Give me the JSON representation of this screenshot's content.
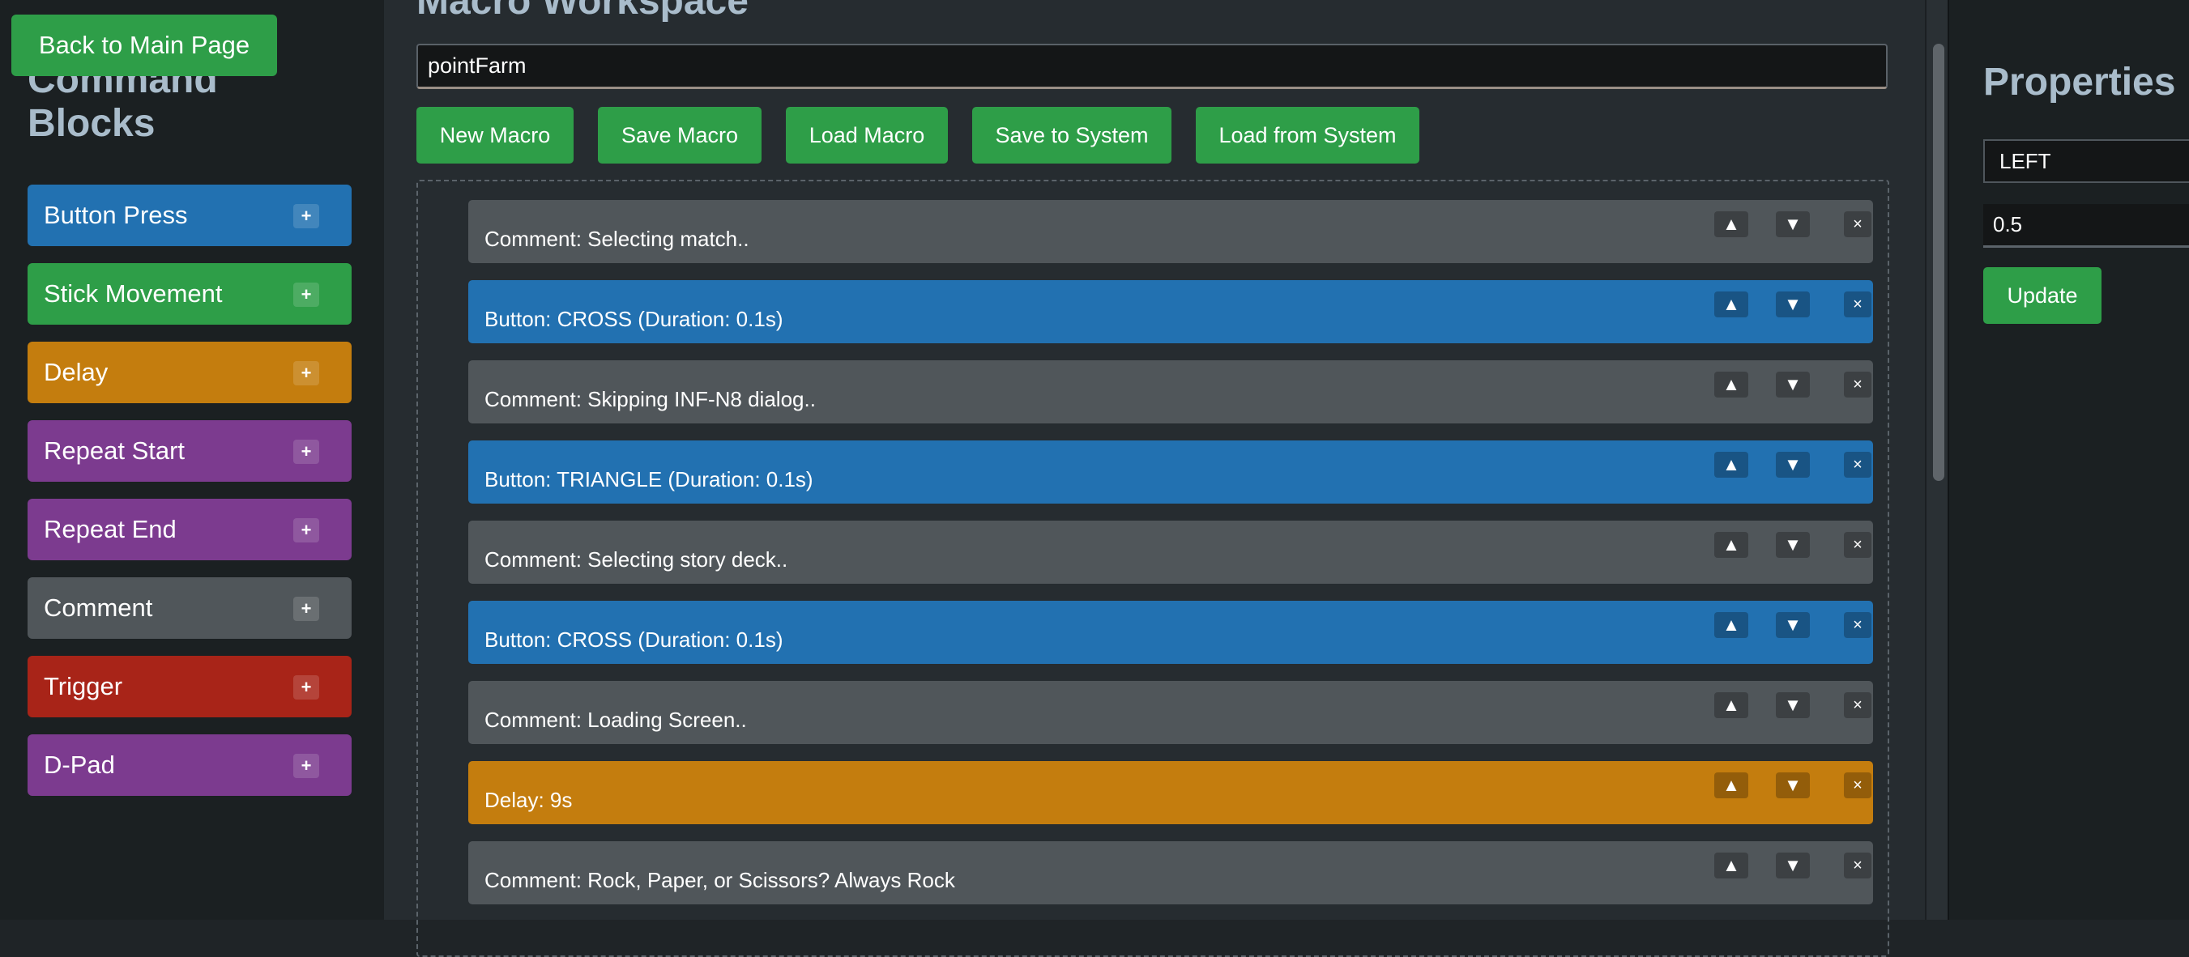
{
  "back_button": "Back to Main Page",
  "sidebar": {
    "title": "Command Blocks",
    "add_symbol": "+",
    "blocks": [
      {
        "label": "Button Press",
        "color": "#2271b1"
      },
      {
        "label": "Stick Movement",
        "color": "#2e9e48"
      },
      {
        "label": "Delay",
        "color": "#c47d0e"
      },
      {
        "label": "Repeat Start",
        "color": "#7c3b8f"
      },
      {
        "label": "Repeat End",
        "color": "#7c3b8f"
      },
      {
        "label": "Comment",
        "color": "#50565a"
      },
      {
        "label": "Trigger",
        "color": "#a82418"
      },
      {
        "label": "D-Pad",
        "color": "#7c3b8f"
      }
    ]
  },
  "workspace": {
    "title": "Macro Workspace",
    "macro_name": "pointFarm",
    "toolbar": {
      "new": "New Macro",
      "save": "Save Macro",
      "load": "Load Macro",
      "save_system": "Save to System",
      "load_system": "Load from System"
    },
    "controls": {
      "up": "▲",
      "down": "▼",
      "delete": "×"
    },
    "items": [
      {
        "text": "Comment: Selecting match..",
        "color": "#50565a"
      },
      {
        "text": "Button: CROSS (Duration: 0.1s)",
        "color": "#2271b1"
      },
      {
        "text": "Comment: Skipping INF-N8 dialog..",
        "color": "#50565a"
      },
      {
        "text": "Button: TRIANGLE (Duration: 0.1s)",
        "color": "#2271b1"
      },
      {
        "text": "Comment: Selecting story deck..",
        "color": "#50565a"
      },
      {
        "text": "Button: CROSS (Duration: 0.1s)",
        "color": "#2271b1"
      },
      {
        "text": "Comment: Loading Screen..",
        "color": "#50565a"
      },
      {
        "text": "Delay: 9s",
        "color": "#c47d0e"
      },
      {
        "text": "Comment: Rock, Paper, or Scissors? Always Rock",
        "color": "#50565a"
      }
    ]
  },
  "properties": {
    "title": "Properties",
    "field1": "LEFT",
    "field2": "0.5",
    "update": "Update"
  }
}
